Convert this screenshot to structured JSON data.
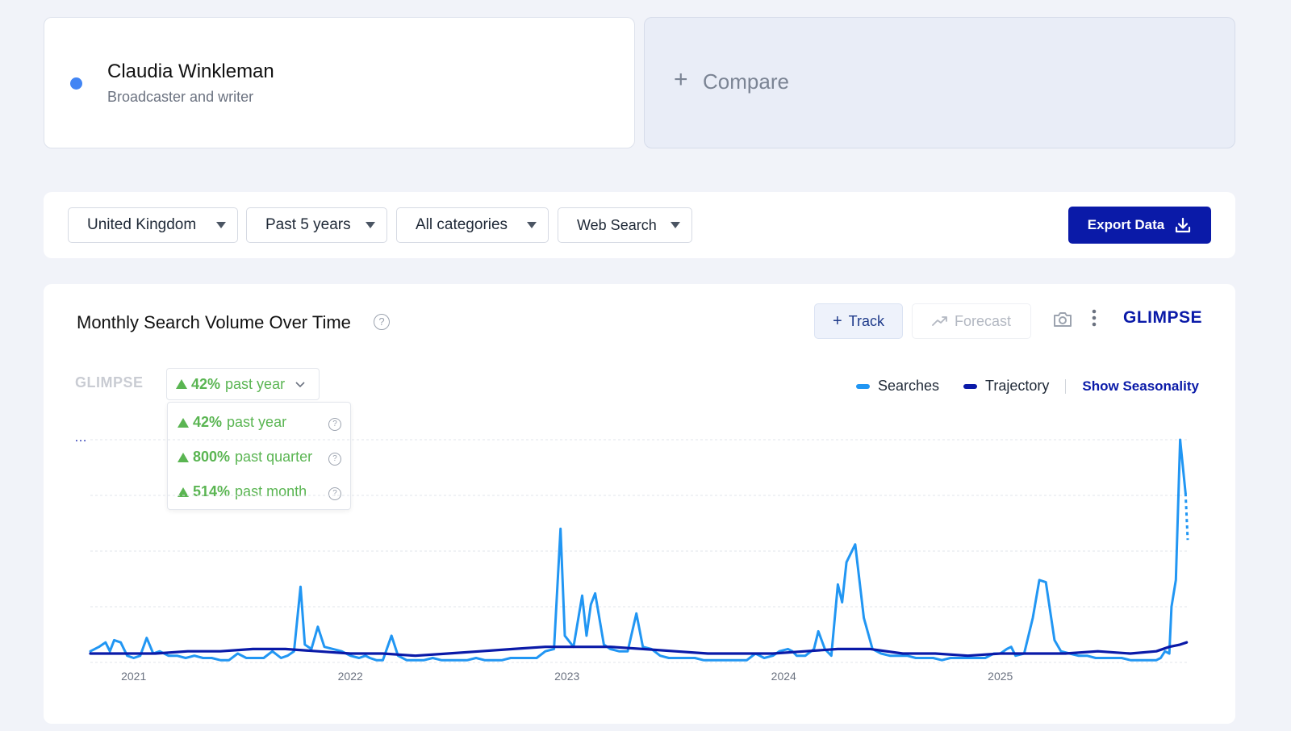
{
  "term": {
    "name": "Claudia Winkleman",
    "subtitle": "Broadcaster and writer",
    "dot_color": "#4285f4"
  },
  "compare": {
    "label": "Compare"
  },
  "filters": {
    "region": "United Kingdom",
    "period": "Past 5 years",
    "category": "All categories",
    "source": "Web Search",
    "export_label": "Export Data"
  },
  "chart_header": {
    "title": "Monthly Search Volume Over Time",
    "track_label": "Track",
    "forecast_label": "Forecast",
    "brand": "GLIMPSE"
  },
  "growth": {
    "selected": {
      "pct": "42%",
      "label": "past year"
    },
    "options": [
      {
        "pct": "42%",
        "label": "past year"
      },
      {
        "pct": "800%",
        "label": "past quarter"
      },
      {
        "pct": "514%",
        "label": "past month"
      }
    ],
    "color": "#5ab552"
  },
  "legend": {
    "searches": "Searches",
    "trajectory": "Trajectory",
    "seasonality": "Show Seasonality"
  },
  "chart_data": {
    "type": "line",
    "title": "Monthly Search Volume Over Time",
    "xlabel": "",
    "ylabel": "",
    "x_ticks": [
      "2021",
      "2022",
      "2023",
      "2024",
      "2025"
    ],
    "ylim": [
      0,
      100
    ],
    "y_gridlines": 5,
    "y_tick_labels_hidden": true,
    "x_range": [
      2020.8,
      2025.85
    ],
    "series": [
      {
        "name": "Searches",
        "color": "#2196f3",
        "points": [
          [
            2020.8,
            5
          ],
          [
            2020.84,
            7
          ],
          [
            2020.87,
            9
          ],
          [
            2020.89,
            5
          ],
          [
            2020.91,
            10
          ],
          [
            2020.94,
            9
          ],
          [
            2020.97,
            3
          ],
          [
            2021.0,
            2
          ],
          [
            2021.03,
            3
          ],
          [
            2021.06,
            11
          ],
          [
            2021.09,
            4
          ],
          [
            2021.12,
            5
          ],
          [
            2021.16,
            3
          ],
          [
            2021.2,
            3
          ],
          [
            2021.24,
            2
          ],
          [
            2021.28,
            3
          ],
          [
            2021.32,
            2
          ],
          [
            2021.36,
            2
          ],
          [
            2021.4,
            1
          ],
          [
            2021.44,
            1
          ],
          [
            2021.48,
            4
          ],
          [
            2021.52,
            2
          ],
          [
            2021.56,
            2
          ],
          [
            2021.6,
            2
          ],
          [
            2021.64,
            5
          ],
          [
            2021.68,
            2
          ],
          [
            2021.71,
            3
          ],
          [
            2021.74,
            5
          ],
          [
            2021.77,
            34
          ],
          [
            2021.79,
            8
          ],
          [
            2021.82,
            6
          ],
          [
            2021.85,
            16
          ],
          [
            2021.88,
            7
          ],
          [
            2021.92,
            6
          ],
          [
            2021.96,
            5
          ],
          [
            2022.0,
            3
          ],
          [
            2022.04,
            2
          ],
          [
            2022.07,
            3
          ],
          [
            2022.09,
            2
          ],
          [
            2022.12,
            1
          ],
          [
            2022.15,
            1
          ],
          [
            2022.19,
            12
          ],
          [
            2022.22,
            3
          ],
          [
            2022.26,
            1
          ],
          [
            2022.3,
            1
          ],
          [
            2022.34,
            1
          ],
          [
            2022.38,
            2
          ],
          [
            2022.42,
            1
          ],
          [
            2022.46,
            1
          ],
          [
            2022.5,
            1
          ],
          [
            2022.54,
            1
          ],
          [
            2022.58,
            2
          ],
          [
            2022.62,
            1
          ],
          [
            2022.66,
            1
          ],
          [
            2022.7,
            1
          ],
          [
            2022.74,
            2
          ],
          [
            2022.78,
            2
          ],
          [
            2022.82,
            2
          ],
          [
            2022.86,
            2
          ],
          [
            2022.9,
            5
          ],
          [
            2022.94,
            6
          ],
          [
            2022.97,
            60
          ],
          [
            2022.99,
            12
          ],
          [
            2023.03,
            7
          ],
          [
            2023.07,
            30
          ],
          [
            2023.09,
            12
          ],
          [
            2023.11,
            26
          ],
          [
            2023.13,
            31
          ],
          [
            2023.17,
            8
          ],
          [
            2023.2,
            6
          ],
          [
            2023.24,
            5
          ],
          [
            2023.28,
            5
          ],
          [
            2023.32,
            22
          ],
          [
            2023.35,
            7
          ],
          [
            2023.39,
            6
          ],
          [
            2023.43,
            3
          ],
          [
            2023.47,
            2
          ],
          [
            2023.51,
            2
          ],
          [
            2023.55,
            2
          ],
          [
            2023.59,
            2
          ],
          [
            2023.63,
            1
          ],
          [
            2023.67,
            1
          ],
          [
            2023.71,
            1
          ],
          [
            2023.75,
            1
          ],
          [
            2023.79,
            1
          ],
          [
            2023.83,
            1
          ],
          [
            2023.87,
            4
          ],
          [
            2023.91,
            2
          ],
          [
            2023.95,
            3
          ],
          [
            2023.98,
            5
          ],
          [
            2024.02,
            6
          ],
          [
            2024.04,
            5
          ],
          [
            2024.06,
            3
          ],
          [
            2024.1,
            3
          ],
          [
            2024.14,
            6
          ],
          [
            2024.16,
            14
          ],
          [
            2024.19,
            6
          ],
          [
            2024.22,
            3
          ],
          [
            2024.25,
            35
          ],
          [
            2024.27,
            27
          ],
          [
            2024.29,
            45
          ],
          [
            2024.33,
            53
          ],
          [
            2024.37,
            20
          ],
          [
            2024.41,
            6
          ],
          [
            2024.45,
            4
          ],
          [
            2024.49,
            3
          ],
          [
            2024.53,
            3
          ],
          [
            2024.57,
            3
          ],
          [
            2024.61,
            2
          ],
          [
            2024.65,
            2
          ],
          [
            2024.69,
            2
          ],
          [
            2024.73,
            1
          ],
          [
            2024.77,
            2
          ],
          [
            2024.81,
            2
          ],
          [
            2024.85,
            2
          ],
          [
            2024.89,
            2
          ],
          [
            2024.93,
            2
          ],
          [
            2024.97,
            4
          ],
          [
            2025.0,
            4
          ],
          [
            2025.03,
            6
          ],
          [
            2025.05,
            7
          ],
          [
            2025.07,
            3
          ],
          [
            2025.11,
            4
          ],
          [
            2025.15,
            20
          ],
          [
            2025.18,
            37
          ],
          [
            2025.21,
            36
          ],
          [
            2025.25,
            10
          ],
          [
            2025.28,
            5
          ],
          [
            2025.32,
            4
          ],
          [
            2025.36,
            3
          ],
          [
            2025.4,
            3
          ],
          [
            2025.44,
            2
          ],
          [
            2025.48,
            2
          ],
          [
            2025.52,
            2
          ],
          [
            2025.56,
            2
          ],
          [
            2025.6,
            1
          ],
          [
            2025.64,
            1
          ],
          [
            2025.68,
            1
          ],
          [
            2025.72,
            1
          ],
          [
            2025.74,
            2
          ],
          [
            2025.76,
            5
          ],
          [
            2025.78,
            4
          ],
          [
            2025.79,
            25
          ],
          [
            2025.81,
            37
          ],
          [
            2025.83,
            100
          ],
          [
            2025.855,
            76
          ]
        ],
        "projected": [
          [
            2025.855,
            76
          ],
          [
            2025.865,
            55
          ]
        ]
      },
      {
        "name": "Trajectory",
        "color": "#0a1aa8",
        "points": [
          [
            2020.8,
            4
          ],
          [
            2020.95,
            4
          ],
          [
            2021.1,
            4
          ],
          [
            2021.25,
            5
          ],
          [
            2021.4,
            5
          ],
          [
            2021.55,
            6
          ],
          [
            2021.7,
            6
          ],
          [
            2021.85,
            5
          ],
          [
            2022.0,
            4
          ],
          [
            2022.15,
            4
          ],
          [
            2022.3,
            3
          ],
          [
            2022.45,
            4
          ],
          [
            2022.6,
            5
          ],
          [
            2022.75,
            6
          ],
          [
            2022.9,
            7
          ],
          [
            2023.05,
            7
          ],
          [
            2023.2,
            7
          ],
          [
            2023.35,
            6
          ],
          [
            2023.5,
            5
          ],
          [
            2023.65,
            4
          ],
          [
            2023.8,
            4
          ],
          [
            2023.95,
            4
          ],
          [
            2024.1,
            5
          ],
          [
            2024.25,
            6
          ],
          [
            2024.4,
            6
          ],
          [
            2024.55,
            4
          ],
          [
            2024.7,
            4
          ],
          [
            2024.85,
            3
          ],
          [
            2025.0,
            4
          ],
          [
            2025.15,
            4
          ],
          [
            2025.3,
            4
          ],
          [
            2025.45,
            5
          ],
          [
            2025.6,
            4
          ],
          [
            2025.72,
            5
          ],
          [
            2025.78,
            7
          ],
          [
            2025.83,
            8
          ],
          [
            2025.86,
            9
          ]
        ]
      }
    ]
  }
}
